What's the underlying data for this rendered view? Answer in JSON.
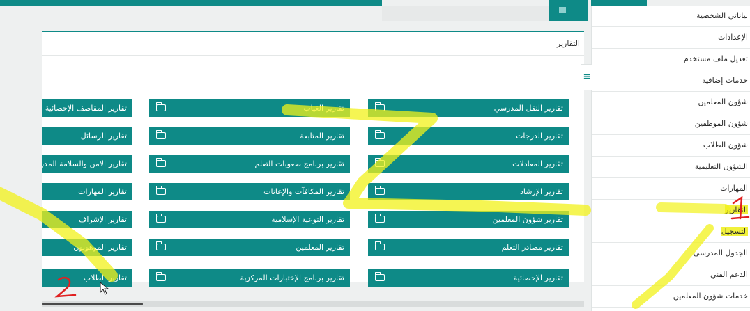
{
  "sidebar": {
    "items": [
      {
        "label": "بياناتي الشخصية"
      },
      {
        "label": "الإعدادات"
      },
      {
        "label": "تعديل ملف مستخدم"
      },
      {
        "label": "خدمات إضافية"
      },
      {
        "label": "شؤون المعلمين"
      },
      {
        "label": "شؤون الموظفين"
      },
      {
        "label": "شؤون الطلاب"
      },
      {
        "label": "الشؤون التعليمية"
      },
      {
        "label": "المهارات"
      },
      {
        "label": "التقارير"
      },
      {
        "label": "التسجيل"
      },
      {
        "label": "الجدول المدرسي"
      },
      {
        "label": "الدعم الفني"
      },
      {
        "label": "خدمات شؤون المعلمين"
      }
    ],
    "toggle_icon": "≡"
  },
  "panel": {
    "title": "التقارير"
  },
  "reports": {
    "col1": [
      "تقارير النقل المدرسي",
      "تقارير الدرجات",
      "تقارير المعادلات",
      "تقارير الإرشاد",
      "تقارير شؤون المعلمين",
      "تقارير مصادر التعلم",
      "تقارير الإحصائية"
    ],
    "col2": [
      "تقارير الغياب",
      "تقارير المتابعة",
      "تقارير برنامج صعوبات التعلم",
      "تقارير المكافآت والإعانات",
      "تقارير التوعية الإسلامية",
      "تقارير المعلمين",
      "تقارير برنامج الإختبارات المركزية"
    ],
    "col3": [
      "تقارير المقاصف الإحصائية",
      "تقارير الرسائل",
      "تقارير الامن والسلامة المدرسية",
      "تقارير المهارات",
      "تقارير الإشراف",
      "تقارير الموهوبون",
      "تقارير الطلاب"
    ]
  },
  "annotations": {
    "mark_1": "1",
    "mark_2": "2"
  },
  "colors": {
    "accent": "#0e8a87",
    "highlight": "#f1f13b"
  }
}
